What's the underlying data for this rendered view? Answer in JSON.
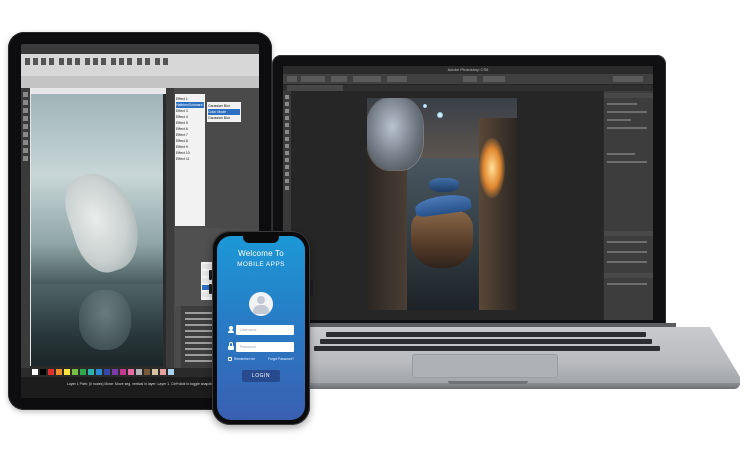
{
  "phone": {
    "welcome_title": "Welcome To",
    "subtitle": "MOBILE APPS",
    "username_placeholder": "Username",
    "password_placeholder": "Password",
    "remember_label": "Remember me",
    "forgot_label": "Forgot Password?",
    "login_label": "LOGIN"
  },
  "laptop": {
    "window_title": "Adobe Photoshop CS6"
  },
  "tablet": {
    "effects_list": [
      "Effect 1",
      "Halbton/Schwarz-Weiß",
      "Effect 3",
      "Effect 4",
      "Effect 5",
      "Effect 6",
      "Effect 7",
      "Effect 8",
      "Effect 9",
      "Effect 10",
      "Effect 11"
    ],
    "blend_list": [
      "Gaussian Blur",
      "Color Mode",
      "Gaussian Blur"
    ],
    "status_text": "Layer 1  Path: (0 nodes) Move: Move seg. vertical in layer: Layer 1. Ctrl+click to toggle snap/drag mode."
  },
  "colors": {
    "phone_gradient_top": "#1c98d6",
    "phone_gradient_bottom": "#3a5fb1",
    "login_button": "#274a8e",
    "laptop_body": "#b9bbbf"
  }
}
